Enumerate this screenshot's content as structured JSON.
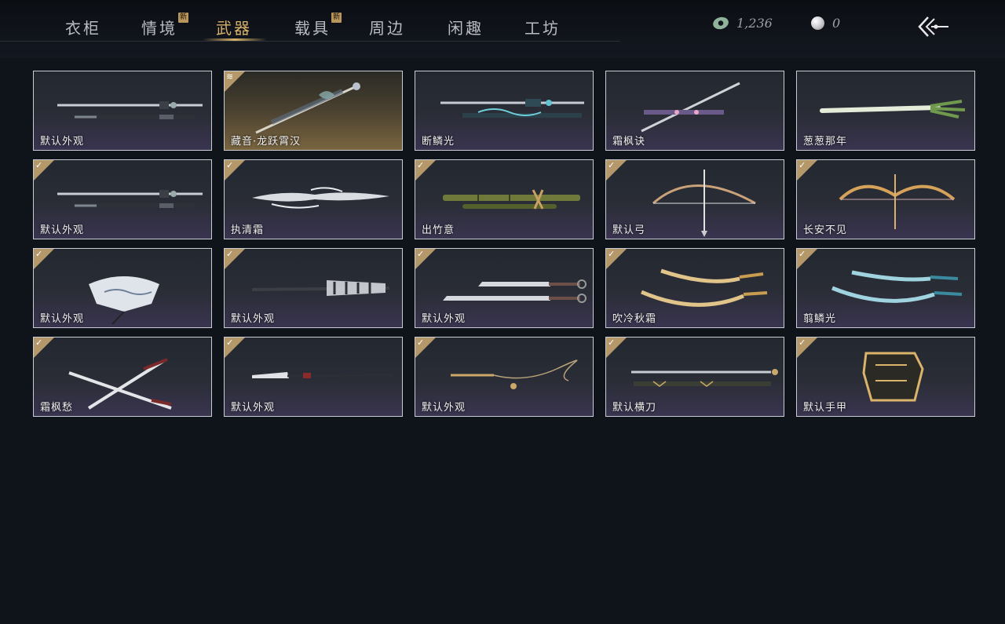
{
  "tabs": [
    {
      "label": "衣柜",
      "new": false
    },
    {
      "label": "情境",
      "new": true
    },
    {
      "label": "武器",
      "new": false,
      "active": true
    },
    {
      "label": "载具",
      "new": true
    },
    {
      "label": "周边",
      "new": false
    },
    {
      "label": "闲趣",
      "new": false
    },
    {
      "label": "工坊",
      "new": false
    }
  ],
  "new_badge_label": "新",
  "currency": {
    "jade_amount": "1,236",
    "pearl_amount": "0"
  },
  "items": [
    {
      "name": "默认外观",
      "badge": "none",
      "art": "sword"
    },
    {
      "name": "藏音·龙跃霄汉",
      "badge": "stack",
      "art": "sword-gold"
    },
    {
      "name": "断鳞光",
      "badge": "none",
      "art": "sword-teal"
    },
    {
      "name": "霜枫诀",
      "badge": "none",
      "art": "sword-diag"
    },
    {
      "name": "葱葱那年",
      "badge": "none",
      "art": "leek"
    },
    {
      "name": "默认外观",
      "badge": "check",
      "art": "sword"
    },
    {
      "name": "执清霜",
      "badge": "check",
      "art": "frost"
    },
    {
      "name": "出竹意",
      "badge": "check",
      "art": "bamboo"
    },
    {
      "name": "默认弓",
      "badge": "check",
      "art": "bow"
    },
    {
      "name": "长安不见",
      "badge": "check",
      "art": "bow-gold"
    },
    {
      "name": "默认外观",
      "badge": "check",
      "art": "fan"
    },
    {
      "name": "默认外观",
      "badge": "check",
      "art": "umbrella"
    },
    {
      "name": "默认外观",
      "badge": "check",
      "art": "dual-blades"
    },
    {
      "name": "吹冷秋霜",
      "badge": "check",
      "art": "curved-gold"
    },
    {
      "name": "翦鳞光",
      "badge": "check",
      "art": "curved-teal"
    },
    {
      "name": "霜枫愁",
      "badge": "check",
      "art": "crossed"
    },
    {
      "name": "默认外观",
      "badge": "check",
      "art": "spear"
    },
    {
      "name": "默认外观",
      "badge": "check",
      "art": "rope-dart"
    },
    {
      "name": "默认横刀",
      "badge": "check",
      "art": "hengdao"
    },
    {
      "name": "默认手甲",
      "badge": "check",
      "art": "gauntlet"
    }
  ]
}
